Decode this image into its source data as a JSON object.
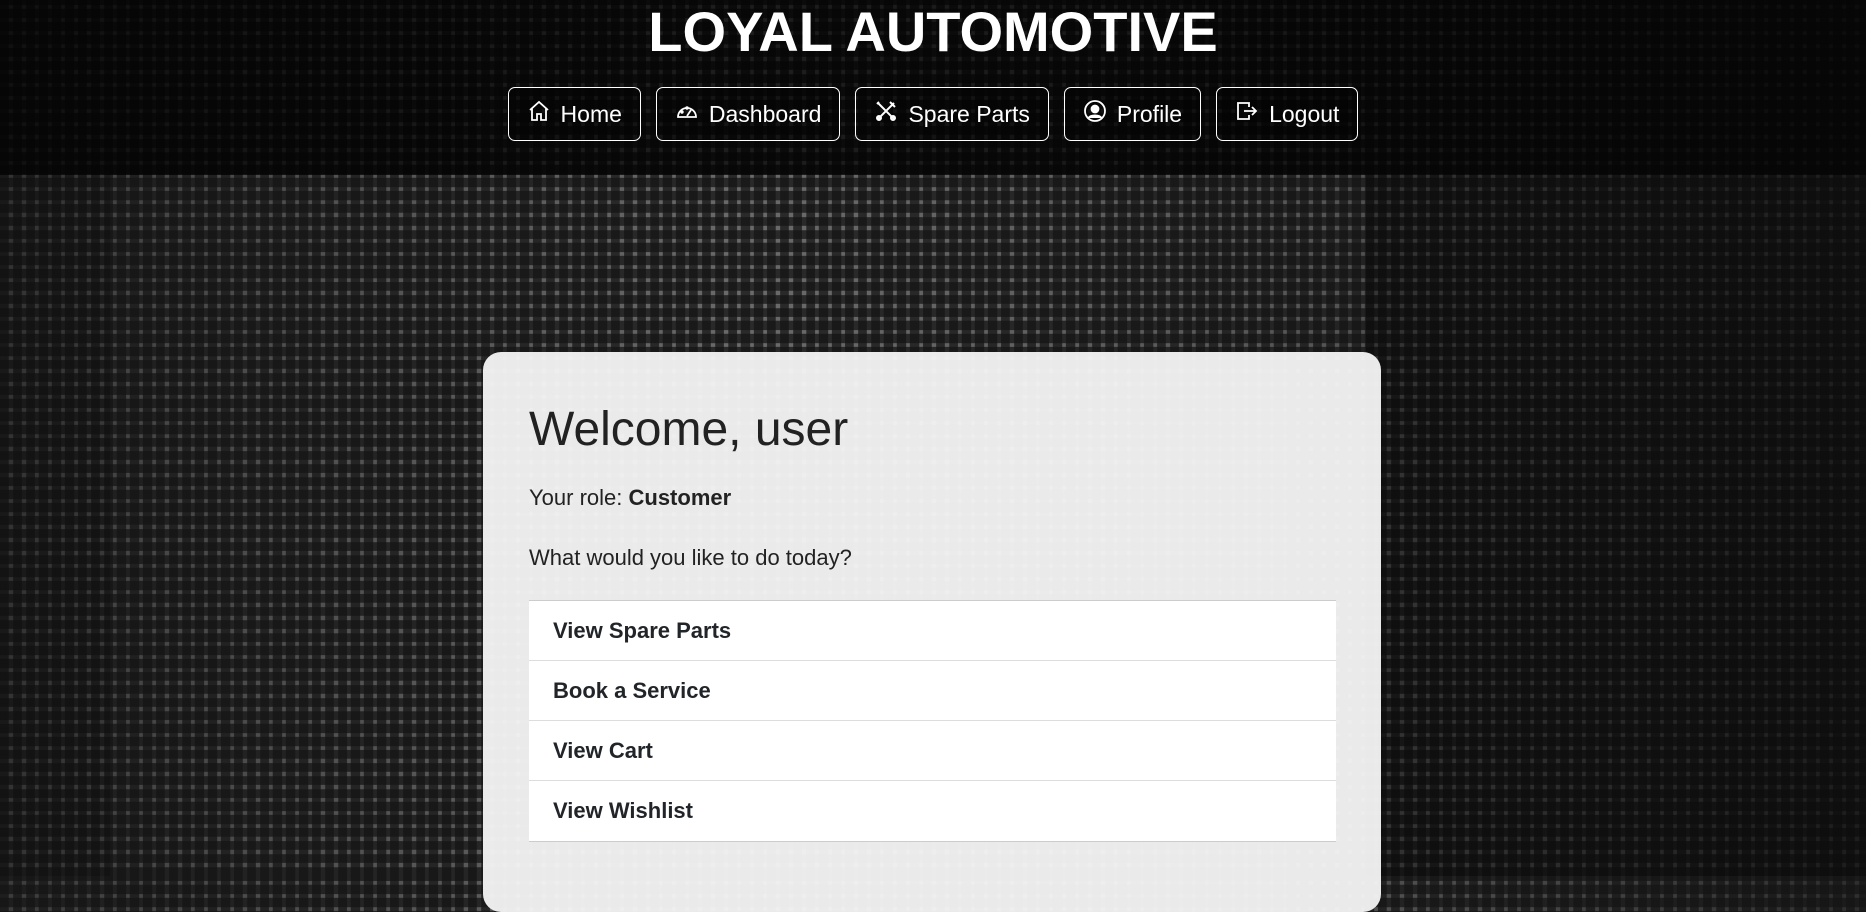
{
  "header": {
    "title": "LOYAL AUTOMOTIVE"
  },
  "nav": [
    {
      "label": "Home",
      "icon": "home-icon"
    },
    {
      "label": "Dashboard",
      "icon": "speedometer-icon"
    },
    {
      "label": "Spare Parts",
      "icon": "tools-icon"
    },
    {
      "label": "Profile",
      "icon": "user-circle-icon"
    },
    {
      "label": "Logout",
      "icon": "logout-icon"
    }
  ],
  "card": {
    "heading": "Welcome, user",
    "role_label": "Your role:",
    "role_value": "Customer",
    "prompt": "What would you like to do today?",
    "actions": [
      "View Spare Parts",
      "Book a Service",
      "View Cart",
      "View Wishlist"
    ]
  }
}
